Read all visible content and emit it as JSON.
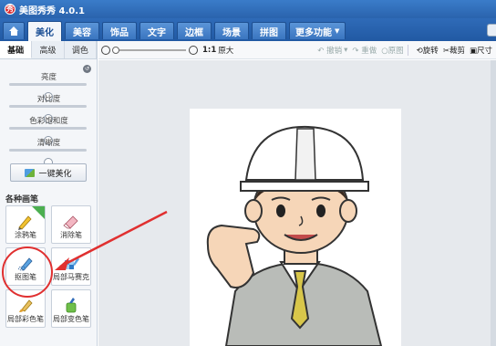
{
  "window": {
    "title": "美图秀秀 4.0.1",
    "logo_glyph": "秀"
  },
  "nav": {
    "home_icon": "home-icon",
    "tabs": [
      "美化",
      "美容",
      "饰品",
      "文字",
      "边框",
      "场景",
      "拼图"
    ],
    "more_label": "更多功能",
    "active_tab": "美化"
  },
  "left": {
    "subtabs": [
      "基础",
      "高级",
      "调色"
    ],
    "sliders": [
      {
        "label": "亮度",
        "value": 0.5
      },
      {
        "label": "对比度",
        "value": 0.5
      },
      {
        "label": "色彩饱和度",
        "value": 0.5
      },
      {
        "label": "清晰度",
        "value": 0.5
      }
    ],
    "one_key_label": "一键美化",
    "section_title": "各种画笔",
    "tools": [
      {
        "label": "涂鸦笔",
        "icon": "brush-icon"
      },
      {
        "label": "消除笔",
        "icon": "eraser-icon"
      },
      {
        "label": "抠图笔",
        "icon": "cutout-pen-icon"
      },
      {
        "label": "局部马赛克",
        "icon": "mosaic-icon"
      },
      {
        "label": "局部彩色笔",
        "icon": "color-brush-icon"
      },
      {
        "label": "局部变色笔",
        "icon": "recolor-brush-icon"
      }
    ]
  },
  "toolbar": {
    "zoom_ratio_label": "1:1",
    "original_label": "原大",
    "undo_label": "撤销",
    "redo_label": "重做",
    "original_image_label": "原图",
    "rotate_label": "旋转",
    "crop_label": "裁剪",
    "size_label": "尺寸"
  },
  "colors": {
    "title_bar": "#2a63ad",
    "annotation_red": "#e03030",
    "helmet": "#ffffff",
    "suit": "#b9bcb8",
    "tie": "#d8c64a"
  }
}
